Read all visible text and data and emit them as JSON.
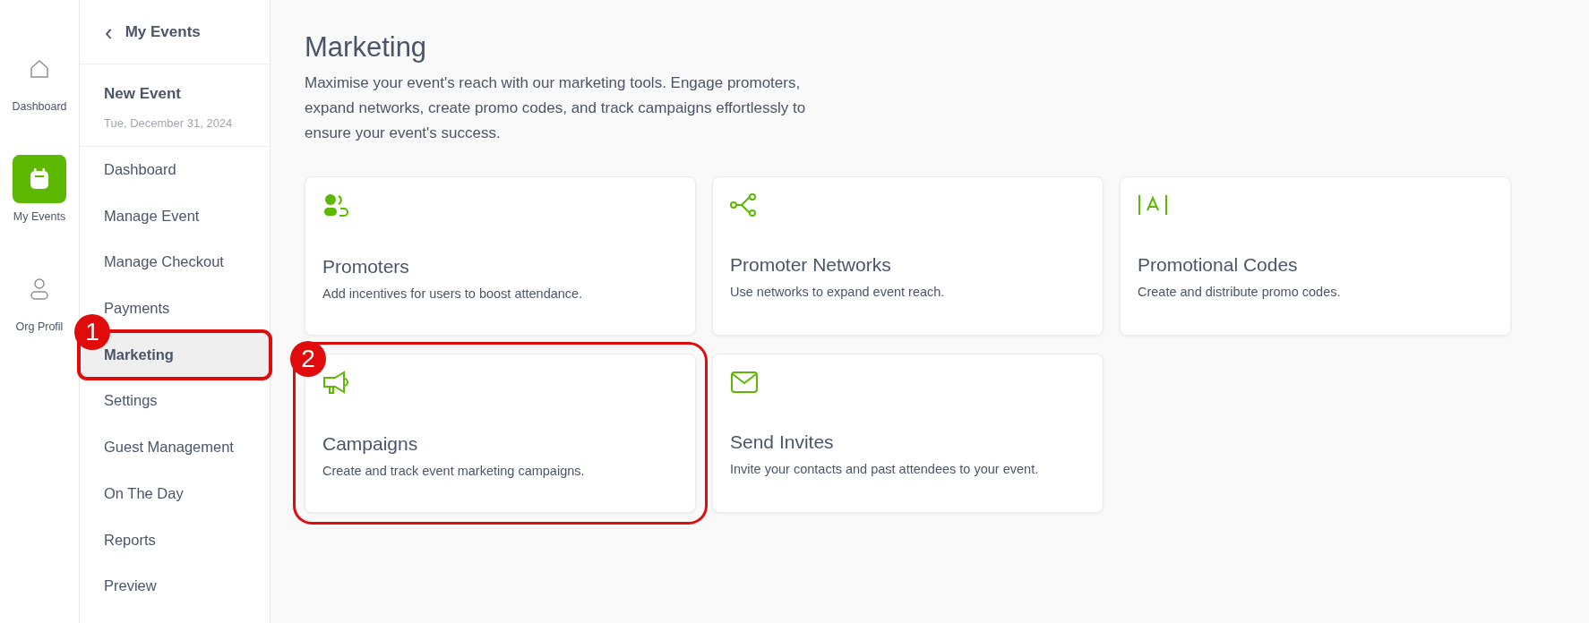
{
  "rail": [
    {
      "label": "Dashboard",
      "kind": "home",
      "selected": false
    },
    {
      "label": "My Events",
      "kind": "calendar",
      "selected": true
    },
    {
      "label": "Org Profil",
      "kind": "person",
      "selected": false
    }
  ],
  "sidebar": {
    "back": "‹",
    "title": "My Events",
    "event_name": "New Event",
    "event_date": "Tue, December 31, 2024",
    "items": [
      {
        "label": "Dashboard",
        "selected": false
      },
      {
        "label": "Manage Event",
        "selected": false
      },
      {
        "label": "Manage Checkout",
        "selected": false
      },
      {
        "label": "Payments",
        "selected": false
      },
      {
        "label": "Marketing",
        "selected": true,
        "annotation": "1"
      },
      {
        "label": "Settings",
        "selected": false
      },
      {
        "label": "Guest Management",
        "selected": false
      },
      {
        "label": "On The Day",
        "selected": false
      },
      {
        "label": "Reports",
        "selected": false
      },
      {
        "label": "Preview",
        "selected": false
      }
    ]
  },
  "page": {
    "title": "Marketing",
    "description": "Maximise your event's reach with our marketing tools. Engage promoters, expand networks, create promo codes, and track campaigns effortlessly to ensure your event's success."
  },
  "cards": [
    {
      "kind": "promoters",
      "title": "Promoters",
      "description": "Add incentives for users to boost attendance."
    },
    {
      "kind": "network",
      "title": "Promoter Networks",
      "description": "Use networks to expand event reach."
    },
    {
      "kind": "code",
      "title": "Promotional Codes",
      "description": "Create and distribute promo codes."
    },
    {
      "kind": "megaphone",
      "title": "Campaigns",
      "description": "Create and track event marketing campaigns.",
      "annotation": "2"
    },
    {
      "kind": "mail",
      "title": "Send Invites",
      "description": "Invite your contacts and past attendees to your event."
    }
  ]
}
